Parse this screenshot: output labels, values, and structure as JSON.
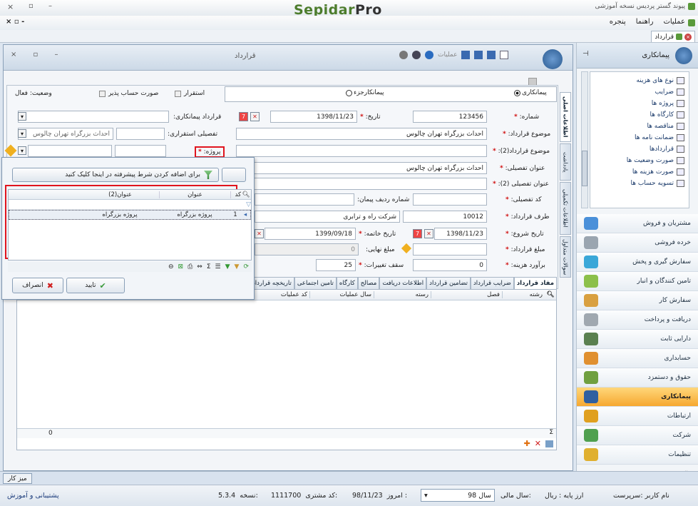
{
  "titlebar": {
    "close": "×",
    "restore": "▫",
    "minimize": "–",
    "logo_main": "Sepidar",
    "logo_pro": "Pro",
    "app_title": "پیوند گستر پردیس نسخه آموزشی"
  },
  "menubar": {
    "left_controls": "× ▫ -",
    "items": [
      "عملیات",
      "راهنما",
      "پنجره"
    ]
  },
  "doc_tab": {
    "label": "قرارداد"
  },
  "sidebar": {
    "header": "پیمانکاری",
    "pin": "⊣",
    "tree": [
      "نوع های هزینه",
      "ضرایب",
      "پروژه ها",
      "کارگاه ها",
      "مناقصه ها",
      "ضمانت نامه ها",
      "قراردادها",
      "صورت وضعیت ها",
      "صورت هزینه ها",
      "تسویه حساب ها"
    ],
    "modules": [
      {
        "label": "مشتریان و فروش",
        "color": "#4a90d9"
      },
      {
        "label": "خرده فروشی",
        "color": "#9aa5b0"
      },
      {
        "label": "سفارش گیری و پخش",
        "color": "#3aa7d8"
      },
      {
        "label": "تامین کنندگان و انبار",
        "color": "#8cc04a"
      },
      {
        "label": "سفارش کار",
        "color": "#d9a040"
      },
      {
        "label": "دریافت و پرداخت",
        "color": "#a0a8b0"
      },
      {
        "label": "دارایی ثابت",
        "color": "#5a8050"
      },
      {
        "label": "حسابداری",
        "color": "#e09030"
      },
      {
        "label": "حقوق و دستمزد",
        "color": "#70a040"
      },
      {
        "label": "پیمانکاری",
        "color": "#3060a0",
        "active": true
      },
      {
        "label": "ارتباطات",
        "color": "#e0a020"
      },
      {
        "label": "شرکت",
        "color": "#50a050"
      },
      {
        "label": "تنظیمات",
        "color": "#e0b030"
      }
    ],
    "more": "»"
  },
  "window": {
    "title": "قرارداد",
    "controls": "× ▫ –",
    "toolbar_ops": "عملیات",
    "radios": {
      "opt1": "پیمانکاری",
      "opt2": "پیمانکارجزء"
    },
    "checks": {
      "settle": "استقرار",
      "invoice": "صورت حساب پذیر",
      "status_label": "وضعیت:",
      "status_value": "فعال"
    },
    "vertical_tabs": [
      "اطلاعات اصلی",
      "یادداشت",
      "اطلاعات تکمیلی",
      "سوالات متداول"
    ],
    "fields": {
      "number_label": "شماره:",
      "number_value": "123456",
      "date_label": "تاریخ:",
      "date_value": "1398/11/23",
      "contractor_label": "قرارداد پیمانکاری:",
      "subject_label": "موضوع قرارداد:",
      "subject_value": "احداث بزرگراه تهران چالوس",
      "detail_settle_label": "تفصیلی استقراری:",
      "detail_settle_value": "احداث بزرگراه تهران چالوس",
      "subject2_label": "موضوع قرارداد(2):",
      "project_label": "پروژه:",
      "detail_title_label": "عنوان تفصیلی:",
      "detail_title_value": "احداث بزرگراه تهران چالوس",
      "detail_title2_label": "عنوان تفصیلی (2):",
      "detail_code_label": "کد تفصیلی:",
      "row_label": "شماره ردیف پیمان:",
      "party_label": "طرف قرارداد:",
      "party_code": "10012",
      "party_name": "شرکت راه و ترابری",
      "start_label": "تاریخ شروع:",
      "start_value": "1398/11/23",
      "end_label": "تاریخ خاتمه:",
      "end_value": "1399/09/18",
      "amount_label": "مبلغ قرارداد:",
      "final_label": "مبلغ نهایی:",
      "final_value": "0",
      "estimate_label": "برآورد هزینه:",
      "estimate_value": "0",
      "cap_label": "سقف تغییرات:",
      "cap_value": "25"
    },
    "bottom_tabs": [
      "مفاد قرارداد",
      "ضرایب قرارداد",
      "تضامین قرارداد",
      "اطلاعات دریافت",
      "مصالح",
      "کارگاه",
      "تامین اجتماعی",
      "تاریخچه قرارداد"
    ],
    "grid_headers": [
      "رشته",
      "فصل",
      "رسته",
      "سال عملیات",
      "کد عملیات"
    ],
    "grid_footer_value": "0",
    "grid_footer_sigma": "Σ"
  },
  "popup": {
    "filter_hint": "برای اضافه کردن شرط پیشرفته در اینجا کلیک کنید",
    "columns": [
      "کد",
      "عنوان",
      "عنوان(2)"
    ],
    "rows": [
      {
        "code": "1",
        "title": "پروژه بزرگراه",
        "title2": "پروژه بزرگراه"
      }
    ],
    "ok": "تایید",
    "cancel": "انصراف"
  },
  "taskbar": {
    "label": "میز کار"
  },
  "status": {
    "user": "نام کاربر :سرپرست",
    "currency": "ارز پایه : ریال",
    "fiscal_label": "سال مالی:",
    "fiscal_value": "سال 98",
    "today_label": "امروز :",
    "today_value": "98/11/23",
    "customer_label": "کد مشتری:",
    "customer_value": "1111700",
    "version_label": "نسخه:",
    "version_value": "5.3.4",
    "support": "پشتیبانی و آموزش"
  }
}
